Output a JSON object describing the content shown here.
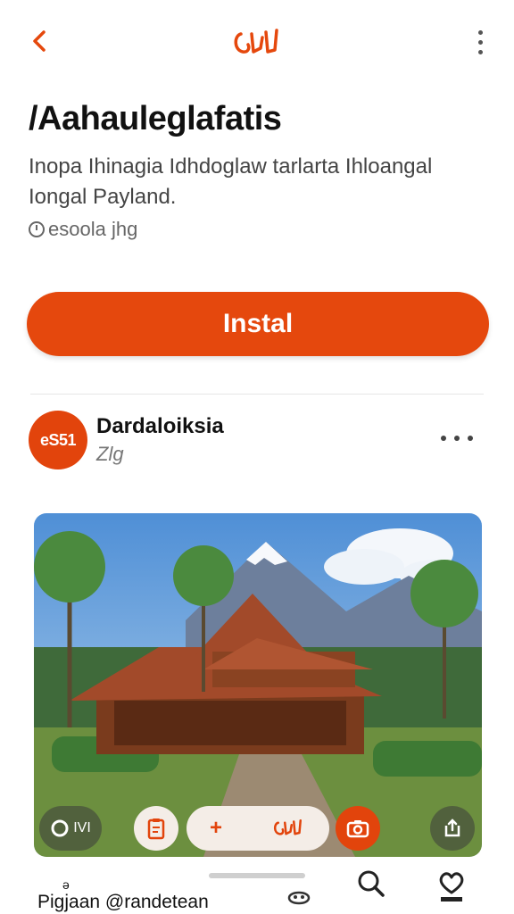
{
  "header": {
    "back_icon": "chevron-left-icon",
    "logo_icon": "brand-logo-icon",
    "menu_icon": "kebab-menu-icon"
  },
  "app": {
    "title": "/Aahauleglafatis",
    "description": "Inopa Ihinagia Idhdoglaw tarlarta Ihloangal Iongal Payland.",
    "meta": "esoola jhg"
  },
  "install_button": {
    "label": "Instal"
  },
  "developer": {
    "avatar_text": "eS51",
    "name": "Dardaloiksia",
    "subtitle": "Zlg"
  },
  "photo_controls": {
    "left_label": "IVI",
    "pill_plus": "+"
  },
  "bottom_nav": {
    "left_small": "ə",
    "left_label": "Pigjaan  @randetean"
  },
  "colors": {
    "accent": "#e5480d",
    "text_primary": "#111111",
    "text_secondary": "#444444",
    "divider": "#e6e6e6"
  }
}
